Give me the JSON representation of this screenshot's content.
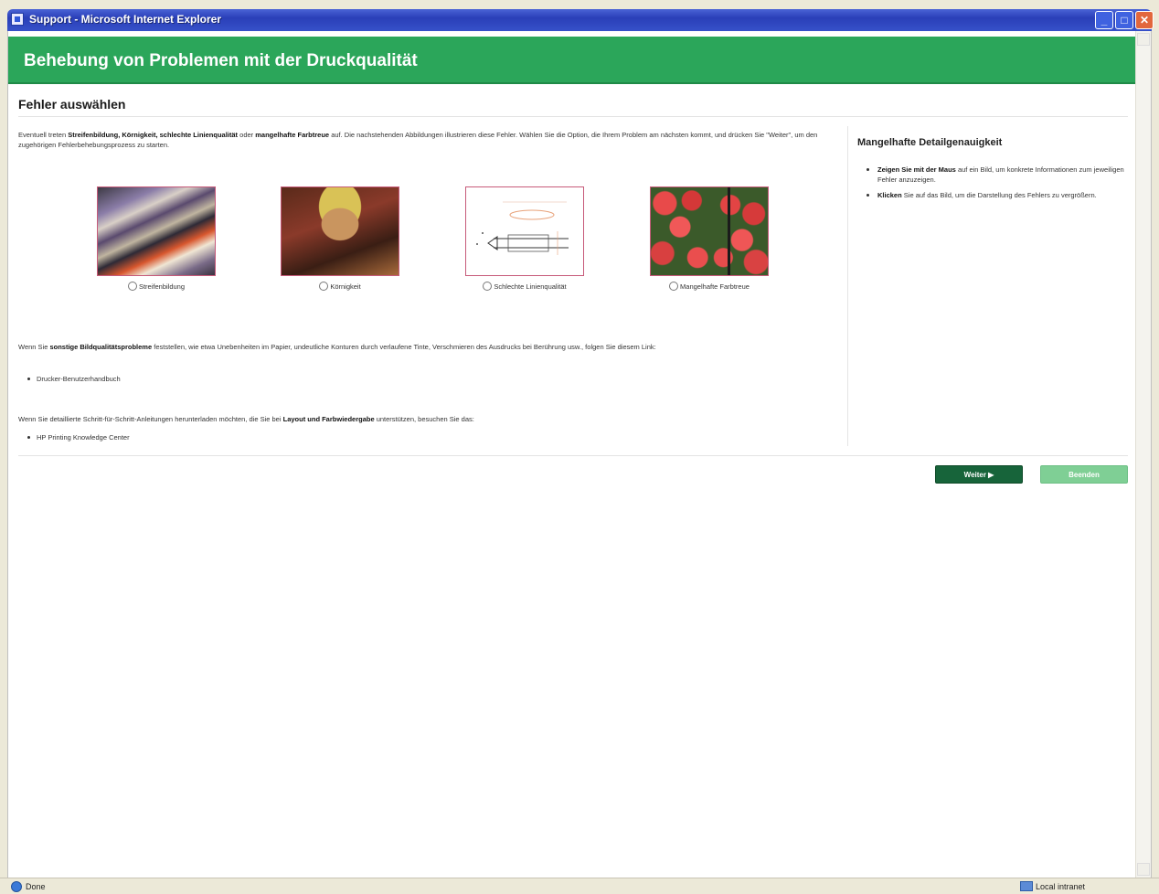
{
  "window": {
    "title": "Support - Microsoft Internet Explorer"
  },
  "header": {
    "title": "Behebung von Problemen mit der Druckqualität"
  },
  "page": {
    "section_title": "Fehler auswählen"
  },
  "intro": {
    "t1": "Eventuell treten ",
    "b1": "Streifenbildung, Körnigkeit, schlechte Linienqualität",
    "t2": " oder ",
    "b2": "mangelhafte Farbtreue",
    "t3": " auf. Die nachstehenden Abbildungen illustrieren diese Fehler. Wählen Sie die Option, die Ihrem Problem am nächsten kommt, und drücken Sie \"Weiter\", um den zugehörigen Fehlerbehebungsprozess zu starten."
  },
  "defects": [
    {
      "label": "Streifenbildung",
      "icon": "banding-sample-image"
    },
    {
      "label": "Körnigkeit",
      "icon": "grainy-sample-image"
    },
    {
      "label": "Schlechte Linienqualität",
      "icon": "line-quality-sample-image"
    },
    {
      "label": "Mangelhafte Farbtreue",
      "icon": "color-fidelity-sample-image"
    }
  ],
  "para2": {
    "t1": "Wenn Sie ",
    "b1": "sonstige Bildqualitätsprobleme",
    "t2": " feststellen, wie etwa Unebenheiten im Papier, undeutliche Konturen durch verlaufene Tinte, Verschmieren des Ausdrucks bei Berührung usw., folgen Sie diesem Link:"
  },
  "link1": "Drucker-Benutzerhandbuch",
  "para3": {
    "t1": "Wenn Sie detaillierte Schritt-für-Schritt-Anleitungen herunterladen möchten, die Sie bei ",
    "b1": "Layout und Farbwiedergabe",
    "t2": " unterstützen, besuchen Sie das:"
  },
  "link2": "HP Printing Knowledge Center",
  "sidebar": {
    "title": "Mangelhafte Detailgenauigkeit",
    "item1_bold": "Zeigen Sie mit der Maus",
    "item1_text": " auf ein Bild, um konkrete Informationen zum jeweiligen Fehler anzuzeigen.",
    "item2_bold": "Klicken",
    "item2_text": " Sie auf das Bild, um die Darstellung des Fehlers zu vergrößern."
  },
  "buttons": {
    "next": "Weiter ▶",
    "cancel": "Beenden"
  },
  "status": {
    "left": "Done",
    "zone": "Local intranet"
  },
  "colors": {
    "header_green": "#2ba65a",
    "next_button": "#17643a",
    "cancel_button": "#7fcf95"
  }
}
